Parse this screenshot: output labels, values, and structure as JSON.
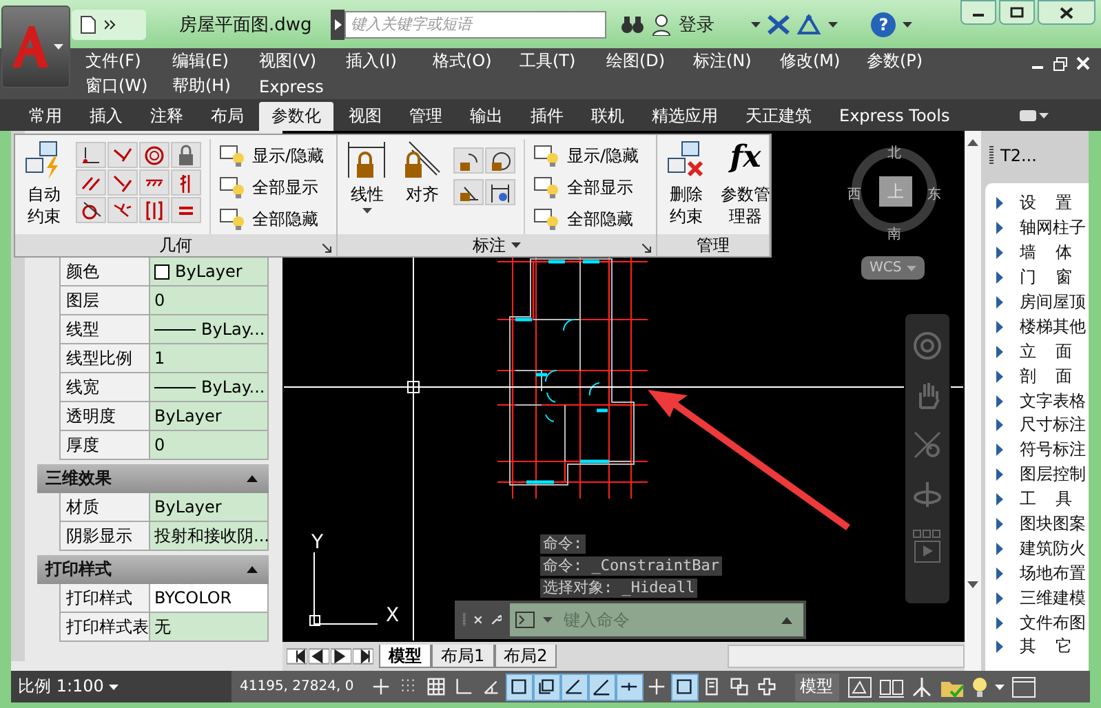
{
  "title_bar": {
    "file_name": "房屋平面图.dwg",
    "search": {
      "placeholder": "键入关键字或短语"
    },
    "sign_in": "登录",
    "help": "?"
  },
  "menu_bar": [
    "文件(F)",
    "编辑(E)",
    "视图(V)",
    "插入(I)",
    "格式(O)",
    "工具(T)",
    "绘图(D)",
    "标注(N)",
    "修改(M)",
    "参数(P)",
    "窗口(W)",
    "帮助(H)",
    "Express"
  ],
  "ribbon_tabs": [
    {
      "label": "常用",
      "selected": false
    },
    {
      "label": "插入",
      "selected": false
    },
    {
      "label": "注释",
      "selected": false
    },
    {
      "label": "布局",
      "selected": false
    },
    {
      "label": "参数化",
      "selected": true
    },
    {
      "label": "视图",
      "selected": false
    },
    {
      "label": "管理",
      "selected": false
    },
    {
      "label": "输出",
      "selected": false
    },
    {
      "label": "插件",
      "selected": false
    },
    {
      "label": "联机",
      "selected": false
    },
    {
      "label": "精选应用",
      "selected": false
    },
    {
      "label": "天正建筑",
      "selected": false
    },
    {
      "label": "Express Tools",
      "selected": false
    }
  ],
  "ribbon": {
    "panels": [
      {
        "title": "几何",
        "has_menu": false,
        "has_launcher": true,
        "large_buttons": [
          {
            "label": "自动约束",
            "has_menu": false
          }
        ],
        "text_buttons": [
          "显示/隐藏",
          "全部显示",
          "全部隐藏"
        ]
      },
      {
        "title": "标注",
        "has_menu": true,
        "has_launcher": true,
        "large_buttons": [
          {
            "label": "线性",
            "has_menu": true
          },
          {
            "label": "对齐",
            "has_menu": false
          }
        ],
        "text_buttons": [
          "显示/隐藏",
          "全部显示",
          "全部隐藏"
        ]
      },
      {
        "title": "管理",
        "has_menu": false,
        "has_launcher": false,
        "large_buttons": [
          {
            "label": "删除约束",
            "has_menu": false
          },
          {
            "label": "参数管理器",
            "has_menu": false,
            "icon_text": "fx"
          }
        ]
      }
    ]
  },
  "properties": {
    "groups": [
      {
        "rows": [
          {
            "label": "颜色",
            "value": "ByLayer",
            "kind": "color",
            "highlighted": true
          },
          {
            "label": "图层",
            "value": "0",
            "kind": "text",
            "highlighted": true
          },
          {
            "label": "线型",
            "value": "ByLay...",
            "kind": "linetype",
            "highlighted": true
          },
          {
            "label": "线型比例",
            "value": "1",
            "kind": "text",
            "highlighted": true
          },
          {
            "label": "线宽",
            "value": "ByLay...",
            "kind": "linetype",
            "highlighted": true
          },
          {
            "label": "透明度",
            "value": "ByLayer",
            "kind": "text",
            "highlighted": true
          },
          {
            "label": "厚度",
            "value": "0",
            "kind": "text",
            "highlighted": true
          }
        ]
      },
      {
        "title": "三维效果",
        "expanded": true,
        "rows": [
          {
            "label": "材质",
            "value": "ByLayer",
            "kind": "text",
            "highlighted": true
          },
          {
            "label": "阴影显示",
            "value": "投射和接收阴...",
            "kind": "text",
            "highlighted": true
          }
        ]
      },
      {
        "title": "打印样式",
        "expanded": true,
        "rows": [
          {
            "label": "打印样式",
            "value": "BYCOLOR",
            "kind": "text",
            "highlighted": false
          },
          {
            "label": "打印样式表",
            "value": "无",
            "kind": "text",
            "highlighted": true
          }
        ]
      }
    ]
  },
  "viewcube": {
    "north": "北",
    "south": "南",
    "east": "东",
    "west": "西",
    "face": "上",
    "ucs_menu": "WCS"
  },
  "ucs_icon": {
    "x_label": "X",
    "y_label": "Y"
  },
  "command_history": [
    "命令:",
    "命令: _ConstraintBar",
    "选择对象: _Hideall"
  ],
  "command_line": {
    "placeholder": "键入命令"
  },
  "layout_tabs": [
    {
      "label": "模型",
      "selected": true
    },
    {
      "label": "布局1",
      "selected": false
    },
    {
      "label": "布局2",
      "selected": false
    }
  ],
  "tool_palette": {
    "title": "T2...",
    "items": [
      "设 置",
      "轴网柱子",
      "墙 体",
      "门 窗",
      "房间屋顶",
      "楼梯其他",
      "立 面",
      "剖 面",
      "文字表格",
      "尺寸标注",
      "符号标注",
      "图层控制",
      "工 具",
      "图块图案",
      "建筑防火",
      "场地布置",
      "三维建模",
      "文件布图",
      "其 它"
    ]
  },
  "status_bar": {
    "scale": "比例 1:100",
    "coordinates": "41195, 27824, 0",
    "space": "模型",
    "toggles": [
      {
        "on": false
      },
      {
        "on": false
      },
      {
        "on": false
      },
      {
        "on": false
      },
      {
        "on": false
      },
      {
        "on": true
      },
      {
        "on": true
      },
      {
        "on": true
      },
      {
        "on": true
      },
      {
        "on": true
      },
      {
        "on": false
      },
      {
        "on": true
      },
      {
        "on": false
      },
      {
        "on": false
      },
      {
        "on": false
      }
    ]
  }
}
